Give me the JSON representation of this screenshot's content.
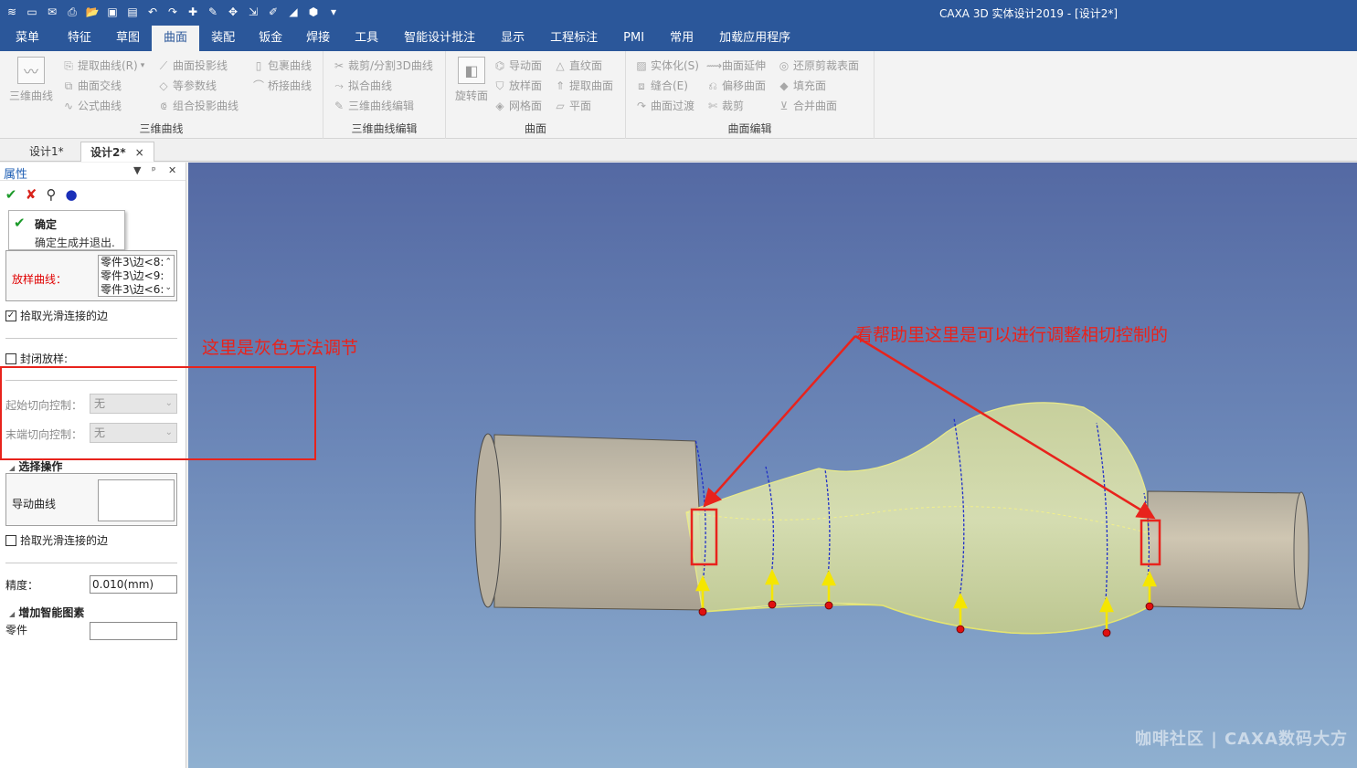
{
  "app": {
    "window_title": "CAXA 3D 实体设计2019 - [设计2*]",
    "quick_access_icons": [
      "app-menu-icon",
      "new-icon",
      "mail-icon",
      "print-icon",
      "open-icon",
      "save-icon",
      "save-as-icon",
      "undo-icon",
      "redo-icon",
      "add-icon",
      "pen-icon",
      "move-icon",
      "import-icon",
      "edit-icon",
      "triangle-icon",
      "shape-icon",
      "more-icon"
    ]
  },
  "ribbon": {
    "tabs": [
      "菜单",
      "特征",
      "草图",
      "曲面",
      "装配",
      "钣金",
      "焊接",
      "工具",
      "智能设计批注",
      "显示",
      "工程标注",
      "PMI",
      "常用",
      "加载应用程序"
    ],
    "active_tab": "曲面",
    "groups": {
      "curve3d": {
        "label": "三维曲线",
        "big_button": "三维曲线",
        "items": [
          "提取曲线(R)",
          "曲面投影线",
          "包裹曲线",
          "曲面交线",
          "等参数线",
          "桥接曲线",
          "公式曲线",
          "组合投影曲线"
        ]
      },
      "curve3d_edit": {
        "label": "三维曲线编辑",
        "items": [
          "裁剪/分割3D曲线",
          "拟合曲线",
          "三维曲线编辑"
        ]
      },
      "surface": {
        "label": "曲面",
        "big_button": "旋转面",
        "items": [
          "导动面",
          "直纹面",
          "放样面",
          "提取曲面",
          "网格面",
          "平面"
        ]
      },
      "surface_edit": {
        "label": "曲面编辑",
        "items": [
          "实体化(S)",
          "曲面延伸",
          "还原剪裁表面",
          "缝合(E)",
          "偏移曲面",
          "填充面",
          "曲面过渡",
          "裁剪",
          "合并曲面"
        ]
      }
    }
  },
  "doc_tabs": [
    {
      "label": "设计1*",
      "active": false
    },
    {
      "label": "设计2*",
      "active": true,
      "close": "×"
    }
  ],
  "panel": {
    "title": "属性",
    "header_buttons": [
      "▼",
      "ᵖ",
      "✕"
    ],
    "tooltip": {
      "title": "确定",
      "desc": "确定生成并退出."
    },
    "loft_label": "放样曲线：",
    "loft_items": [
      "零件3\\边<8:",
      "零件3\\边<9:",
      "零件3\\边<6:"
    ],
    "pick_smooth_1": "拾取光滑连接的边",
    "closed_loft": "封闭放样:",
    "start_tangent_label": "起始切向控制：",
    "start_tangent_value": "无",
    "end_tangent_label": "末端切向控制：",
    "end_tangent_value": "无",
    "select_section": "选择操作",
    "guide_curve_label": "导动曲线",
    "pick_smooth_2": "拾取光滑连接的边",
    "precision_label": "精度：",
    "precision_value": "0.010(mm)",
    "smart_section": "增加智能图素",
    "part_label": "零件",
    "part_value": ""
  },
  "annotations": {
    "left_note": "这里是灰色无法调节",
    "right_note": "看帮助里这里是可以进行调整相切控制的",
    "color": "#e8231c"
  },
  "watermark": "咖啡社区 | CAXA数码大方"
}
